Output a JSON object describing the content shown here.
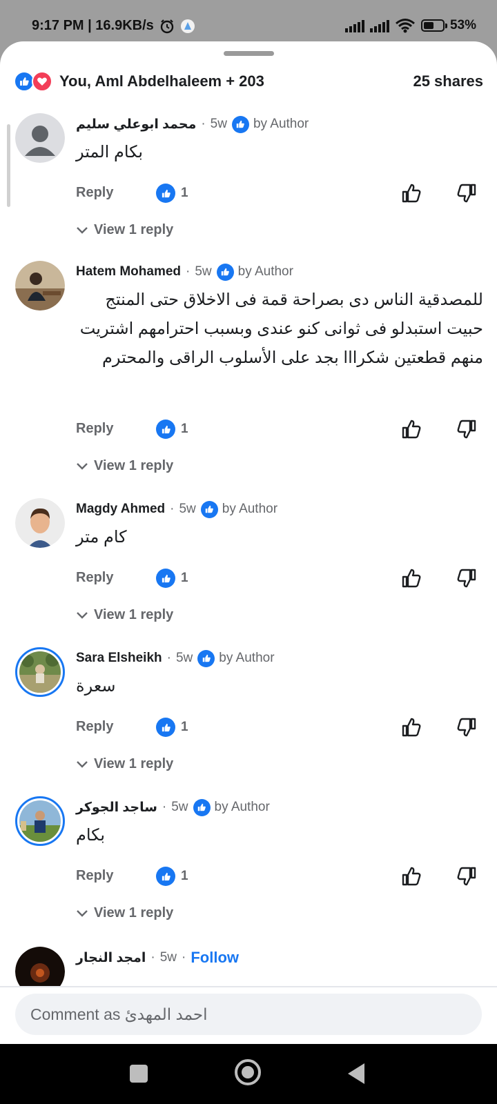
{
  "status_bar": {
    "time_speed": "9:17 PM | 16.9KB/s",
    "battery": "53%",
    "battery_level": 0.53
  },
  "header": {
    "reactions_summary": "You, Aml Abdelhaleem + 203",
    "shares": "25 shares"
  },
  "comments": [
    {
      "name": "محمد ابوعلي سليم",
      "time": "5w",
      "author_label": "by Author",
      "text": "بكام المتر",
      "reply_label": "Reply",
      "likes": "1",
      "view_replies": "View 1 reply"
    },
    {
      "name": "Hatem Mohamed",
      "time": "5w",
      "author_label": "by Author",
      "text": "للمصدقية الناس دى بصراحة قمة فى الاخلاق حتى المنتج حبيت استبدلو فى ثوانى كنو عندى وبسبب احترامهم اشتريت منهم قطعتين شكرااا بجد على الأسلوب الراقى والمحترم",
      "reply_label": "Reply",
      "likes": "1",
      "view_replies": "View 1 reply"
    },
    {
      "name": "Magdy Ahmed",
      "time": "5w",
      "author_label": "by Author",
      "text": "كام متر",
      "reply_label": "Reply",
      "likes": "1",
      "view_replies": "View 1 reply"
    },
    {
      "name": "Sara Elsheikh",
      "time": "5w",
      "author_label": "by Author",
      "text": "سعرة",
      "reply_label": "Reply",
      "likes": "1",
      "view_replies": "View 1 reply"
    },
    {
      "name": "ساجد الجوكر",
      "time": "5w",
      "author_label": "by Author",
      "text": "بكام",
      "reply_label": "Reply",
      "likes": "1",
      "view_replies": "View 1 reply"
    },
    {
      "name": "امجد النجار",
      "time": "5w",
      "follow_label": "Follow"
    }
  ],
  "composer": {
    "placeholder": "Comment as احمد المهدئ"
  },
  "colors": {
    "accent": "#1877f2",
    "love": "#f33e58",
    "muted": "#65676b"
  }
}
